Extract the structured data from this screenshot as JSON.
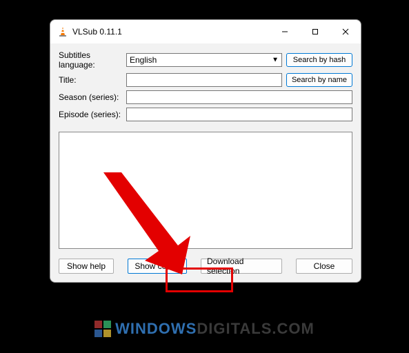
{
  "window": {
    "title": "VLSub 0.11.1"
  },
  "form": {
    "language_label": "Subtitles language:",
    "language_value": "English",
    "title_label": "Title:",
    "title_value": "",
    "season_label": "Season (series):",
    "season_value": "",
    "episode_label": "Episode (series):",
    "episode_value": ""
  },
  "side_buttons": {
    "hash": "Search by hash",
    "name": "Search by name"
  },
  "buttons": {
    "help": "Show help",
    "config": "Show config",
    "download": "Download selection",
    "close": "Close"
  },
  "watermark": {
    "part1": "Windows",
    "part2": "Digitals.com"
  }
}
